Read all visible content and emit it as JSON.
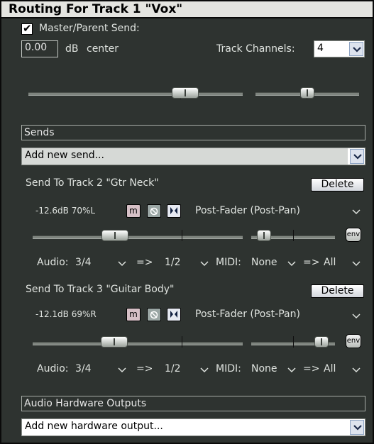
{
  "window": {
    "title": "Routing For Track 1 \"Vox\""
  },
  "master": {
    "send_label": "Master/Parent Send:",
    "checked": true,
    "volume_value": "0.00",
    "db_label": "dB",
    "pan_label": "center",
    "channels_label": "Track Channels:",
    "channels_value": "4"
  },
  "sends": {
    "header": "Sends",
    "add_placeholder": "Add new send...",
    "items": [
      {
        "title": "Send To Track 2 \"Gtr Neck\"",
        "delete_label": "Delete",
        "level": "-12.6dB 70%L",
        "mute_label": "m",
        "mode": "Post-Fader (Post-Pan)",
        "env_label": "env",
        "audio_label": "Audio:",
        "audio_src": "3/4",
        "arrow": "=>",
        "audio_dst": "1/2",
        "midi_label": "MIDI:",
        "midi_src": "None",
        "midi_dst": "All"
      },
      {
        "title": "Send To Track 3 \"Guitar Body\"",
        "delete_label": "Delete",
        "level": "-12.1dB 69%R",
        "mute_label": "m",
        "mode": "Post-Fader (Post-Pan)",
        "env_label": "env",
        "audio_label": "Audio:",
        "audio_src": "3/4",
        "arrow": "=>",
        "audio_dst": "1/2",
        "midi_label": "MIDI:",
        "midi_src": "None",
        "midi_dst": "All"
      }
    ]
  },
  "hardware": {
    "header": "Audio Hardware Outputs",
    "add_placeholder": "Add new hardware output..."
  }
}
